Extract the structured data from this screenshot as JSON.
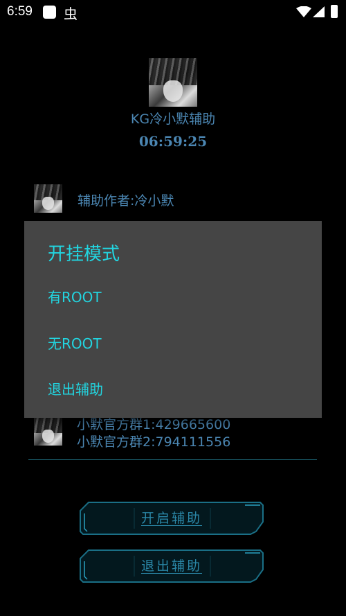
{
  "status_bar": {
    "time": "6:59",
    "icons": [
      "square-icon",
      "bug-icon",
      "wifi-icon",
      "signal-icon",
      "battery-icon"
    ],
    "bug_glyph": "虫"
  },
  "app": {
    "name": "KG冷小默辅助",
    "clock": "06:59:25",
    "author": "辅助作者:冷小默",
    "groups": [
      "小默官方群1:429665600",
      "小默官方群2:794111556"
    ],
    "start_button": "开启辅助",
    "exit_button": "退出辅助"
  },
  "dialog": {
    "title": "开挂模式",
    "items": [
      "有ROOT",
      "无ROOT",
      "退出辅助"
    ]
  },
  "colors": {
    "accent": "#22d5e0",
    "text_blue": "#4b86b2",
    "dialog_bg": "#454545"
  }
}
